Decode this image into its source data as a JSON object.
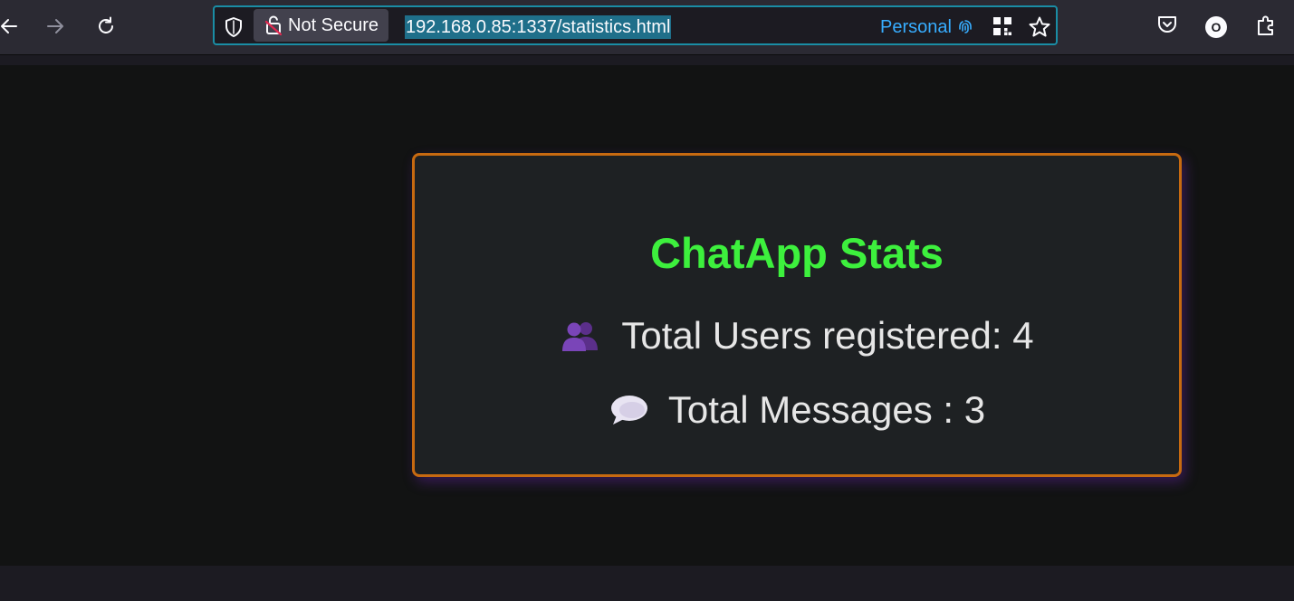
{
  "browser": {
    "security_label": "Not Secure",
    "url": "192.168.0.85:1337/statistics.html",
    "container_name": "Personal",
    "account_initial": "O"
  },
  "icons": {
    "back": "back-arrow-icon",
    "forward": "forward-arrow-icon",
    "reload": "reload-icon",
    "shield": "shield-icon",
    "lock": "broken-lock-icon",
    "fingerprint": "fingerprint-icon",
    "qr": "qr-code-icon",
    "star": "bookmark-star-icon",
    "pocket": "pocket-icon",
    "extensions": "extensions-icon",
    "users": "two-users-emoji",
    "messages": "speech-balloon-emoji"
  },
  "page": {
    "title": "ChatApp Stats",
    "users_text": "Total Users registered: 4",
    "messages_text": "Total Messages : 3"
  },
  "colors": {
    "title": "#3df03d",
    "card_border": "#c76a10",
    "container_accent": "#37adff"
  }
}
